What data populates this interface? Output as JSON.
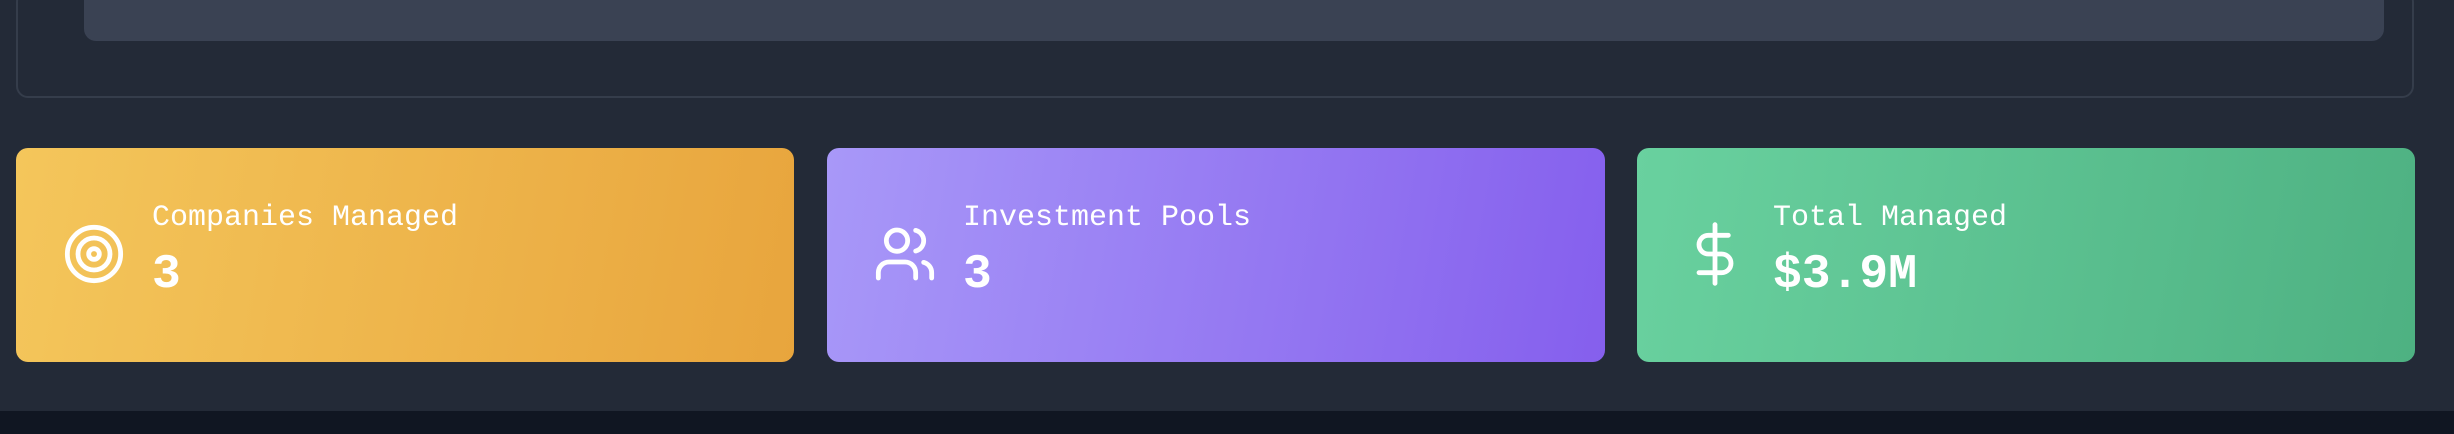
{
  "stats": [
    {
      "label": "Companies Managed",
      "value": "3",
      "icon": "target-icon",
      "color_start": "#f4c65b",
      "color_end": "#e8a53d"
    },
    {
      "label": "Investment Pools",
      "value": "3",
      "icon": "users-icon",
      "color_start": "#a898f8",
      "color_end": "#855fed"
    },
    {
      "label": "Total Managed",
      "value": "$3.9M",
      "icon": "dollar-sign-icon",
      "color_start": "#69d19f",
      "color_end": "#4eb182"
    }
  ],
  "colors": {
    "background": "#232a37",
    "panel_border": "#353d4b",
    "panel_inner": "#3a4253",
    "footer": "#101622"
  }
}
